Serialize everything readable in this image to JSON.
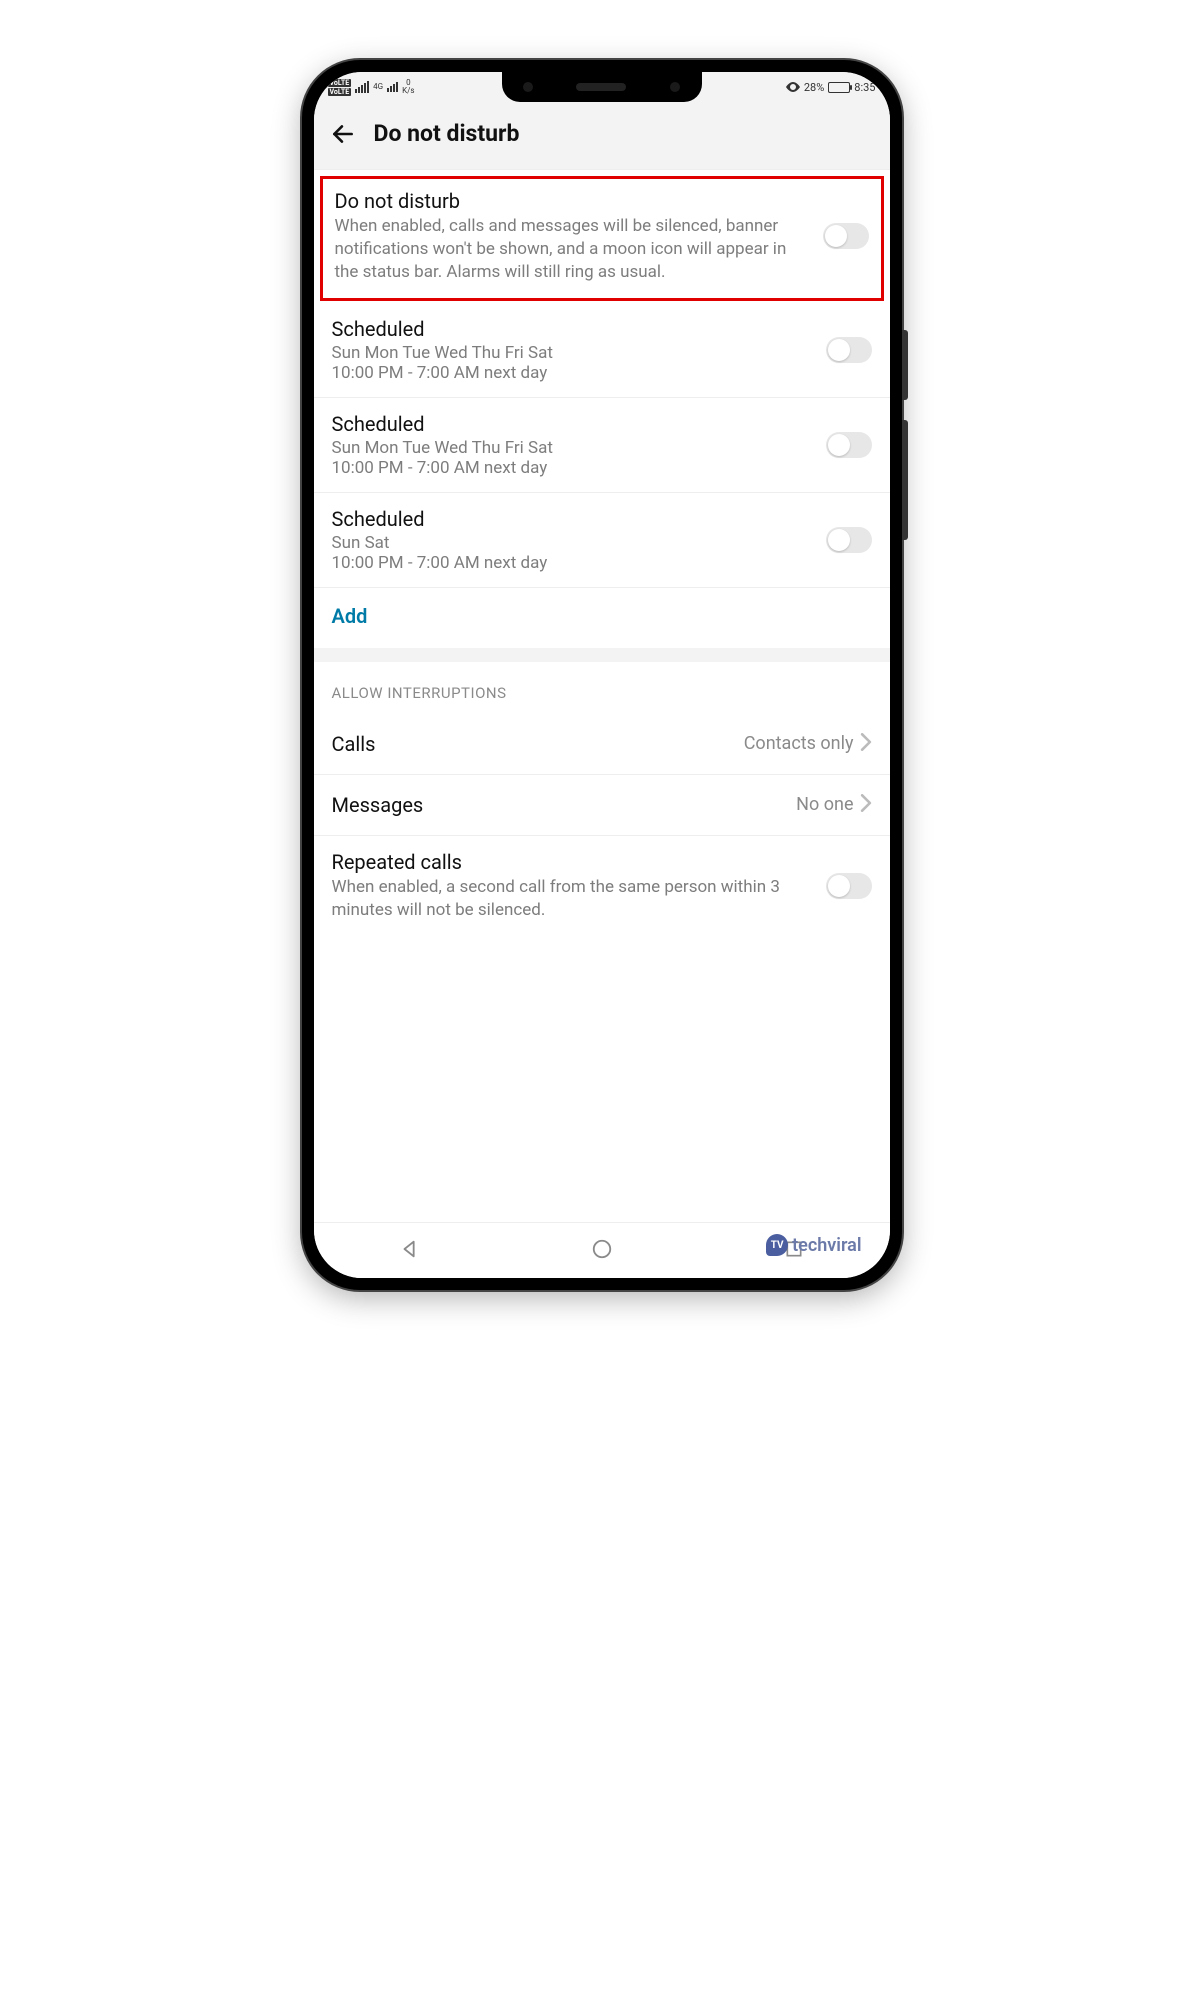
{
  "status": {
    "volte": "VoLTE",
    "net_label": "4G",
    "speed": "0",
    "speed_unit": "K/s",
    "battery_pct": "28%",
    "time": "8:35"
  },
  "header": {
    "title": "Do not disturb"
  },
  "dnd": {
    "title": "Do not disturb",
    "desc": "When enabled, calls and messages will be silenced, banner notifications won't be shown, and a moon icon will appear in the status bar. Alarms will still ring as usual."
  },
  "schedules": [
    {
      "title": "Scheduled",
      "days": "Sun Mon Tue Wed Thu Fri Sat",
      "time": "10:00 PM - 7:00 AM next day"
    },
    {
      "title": "Scheduled",
      "days": "Sun Mon Tue Wed Thu Fri Sat",
      "time": "10:00 PM - 7:00 AM next day"
    },
    {
      "title": "Scheduled",
      "days": "Sun Sat",
      "time": "10:00 PM - 7:00 AM next day"
    }
  ],
  "add_label": "Add",
  "interruptions": {
    "header": "ALLOW INTERRUPTIONS",
    "calls_label": "Calls",
    "calls_value": "Contacts only",
    "messages_label": "Messages",
    "messages_value": "No one",
    "repeated_title": "Repeated calls",
    "repeated_desc": "When enabled, a second call from the same person within 3 minutes will not be silenced."
  },
  "watermark": {
    "badge": "TV",
    "text": "techviral"
  }
}
